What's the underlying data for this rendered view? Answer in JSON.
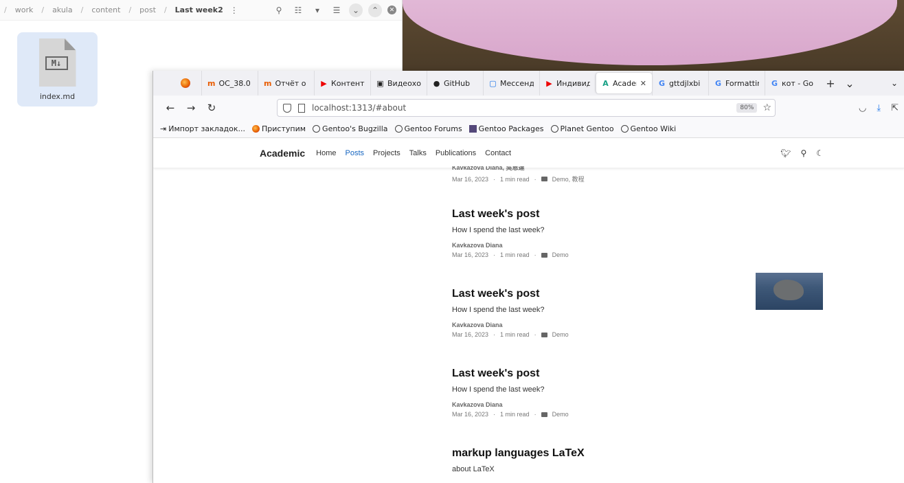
{
  "file_manager": {
    "breadcrumbs": [
      "work",
      "akula",
      "content",
      "post",
      "Last week2"
    ],
    "file": {
      "name": "index.md",
      "icon_text": "M↓"
    }
  },
  "browser": {
    "tabs": [
      {
        "icon": "m",
        "label": "OC_38.0"
      },
      {
        "icon": "m",
        "label": "Отчёт о"
      },
      {
        "icon": "▶",
        "label": "Контент"
      },
      {
        "icon": "▣",
        "label": "Видеохо"
      },
      {
        "icon": "●",
        "label": "GitHub"
      },
      {
        "icon": "▢",
        "label": "Мессенд"
      },
      {
        "icon": "▶",
        "label": "Индивид"
      },
      {
        "icon": "A",
        "label": "Acader",
        "active": true
      },
      {
        "icon": "G",
        "label": "gttdjlxbi"
      },
      {
        "icon": "G",
        "label": "Formattin"
      },
      {
        "icon": "G",
        "label": "кот - Go"
      }
    ],
    "url": "localhost:1313/#about",
    "zoom": "80%",
    "bookmarks": [
      "Импорт закладок...",
      "Приступим",
      "Gentoo's Bugzilla",
      "Gentoo Forums",
      "Gentoo Packages",
      "Planet Gentoo",
      "Gentoo Wiki"
    ]
  },
  "site": {
    "brand": "Academic",
    "menu": [
      "Home",
      "Posts",
      "Projects",
      "Talks",
      "Publications",
      "Contact"
    ],
    "top_partial": {
      "date": "Mar 16, 2023",
      "read": "1 min read",
      "cat": "Demo, 教程",
      "author": "Kavkazova Diana, 吳恩達"
    },
    "posts": [
      {
        "title": "Last week's post",
        "summary": "How I spend the last week?",
        "author": "Kavkazova Diana",
        "date": "Mar 16, 2023",
        "read": "1 min read",
        "cat": "Demo"
      },
      {
        "title": "Last week's post",
        "summary": "How I spend the last week?",
        "author": "Kavkazova Diana",
        "date": "Mar 16, 2023",
        "read": "1 min read",
        "cat": "Demo"
      },
      {
        "title": "Last week's post",
        "summary": "How I spend the last week?",
        "author": "Kavkazova Diana",
        "date": "Mar 16, 2023",
        "read": "1 min read",
        "cat": "Demo"
      },
      {
        "title": "markup languages LaTeX",
        "summary": "about LaTeX"
      }
    ]
  }
}
